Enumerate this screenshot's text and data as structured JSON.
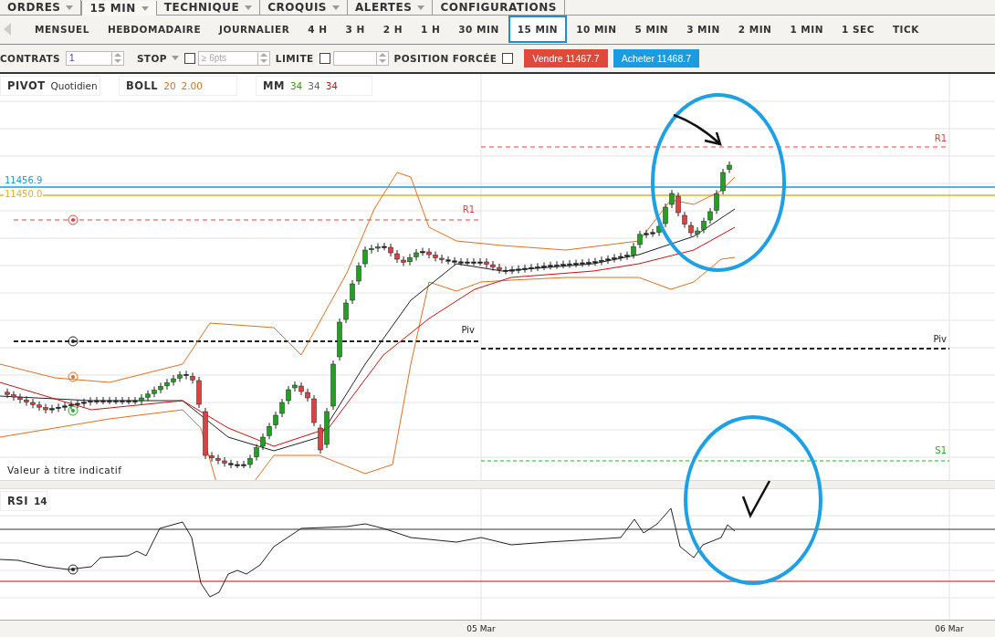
{
  "menu_tabs": [
    {
      "label": "ORDRES",
      "selected": false
    },
    {
      "label": "15 MIN",
      "selected": true
    },
    {
      "label": "TECHNIQUE",
      "selected": false
    },
    {
      "label": "CROQUIS",
      "selected": false
    },
    {
      "label": "ALERTES",
      "selected": false
    },
    {
      "label": "CONFIGURATIONS",
      "selected": false
    }
  ],
  "timeframes": [
    {
      "label": "MENSUEL",
      "selected": false
    },
    {
      "label": "HEBDOMADAIRE",
      "selected": false
    },
    {
      "label": "JOURNALIER",
      "selected": false
    },
    {
      "label": "4 H",
      "selected": false
    },
    {
      "label": "3 H",
      "selected": false
    },
    {
      "label": "2 H",
      "selected": false
    },
    {
      "label": "1 H",
      "selected": false
    },
    {
      "label": "30 MIN",
      "selected": false
    },
    {
      "label": "15 MIN",
      "selected": true
    },
    {
      "label": "10 MIN",
      "selected": false
    },
    {
      "label": "5 MIN",
      "selected": false
    },
    {
      "label": "3 MIN",
      "selected": false
    },
    {
      "label": "2 MIN",
      "selected": false
    },
    {
      "label": "1 MIN",
      "selected": false
    },
    {
      "label": "1 SEC",
      "selected": false
    },
    {
      "label": "TICK",
      "selected": false
    }
  ],
  "order_bar": {
    "contracts": {
      "label": "CONTRATS",
      "value": "1"
    },
    "stop": {
      "label": "STOP",
      "placeholder": "≥ 6pts",
      "checked": false
    },
    "limit": {
      "label": "LIMITE",
      "checked": false
    },
    "forced_position": {
      "label": "POSITION FORCÉE",
      "checked": false
    },
    "sell": "Vendre 11467.7",
    "buy": "Acheter 11468.7"
  },
  "indicators": [
    {
      "name": "PIVOT",
      "params": [
        {
          "text": "Quotidien",
          "color": "#333333"
        }
      ]
    },
    {
      "name": "BOLL",
      "params": [
        {
          "text": "20",
          "color": "#e07020"
        },
        {
          "text": "2.00",
          "color": "#e07020"
        }
      ]
    },
    {
      "name": "MM",
      "params": [
        {
          "text": "34",
          "color": "#3a9a10"
        },
        {
          "text": "34",
          "color": "#666666"
        },
        {
          "text": "34",
          "color": "#cc1010"
        }
      ]
    }
  ],
  "price_lines": [
    {
      "label": "11456.9",
      "color": "#1a9ae0"
    },
    {
      "label": "11450.0",
      "color": "#e8b020"
    }
  ],
  "pivot_labels": [
    {
      "text": "R1",
      "kind": "resistance"
    },
    {
      "text": "Piv",
      "kind": "pivot"
    },
    {
      "text": "R1",
      "kind": "resistance"
    },
    {
      "text": "Piv",
      "kind": "pivot"
    },
    {
      "text": "S1",
      "kind": "support"
    }
  ],
  "disclaimer": "Valeur à titre indicatif",
  "rsi": {
    "name": "RSI",
    "period": "14"
  },
  "x_axis": [
    "05 Mar",
    "06 Mar"
  ]
}
